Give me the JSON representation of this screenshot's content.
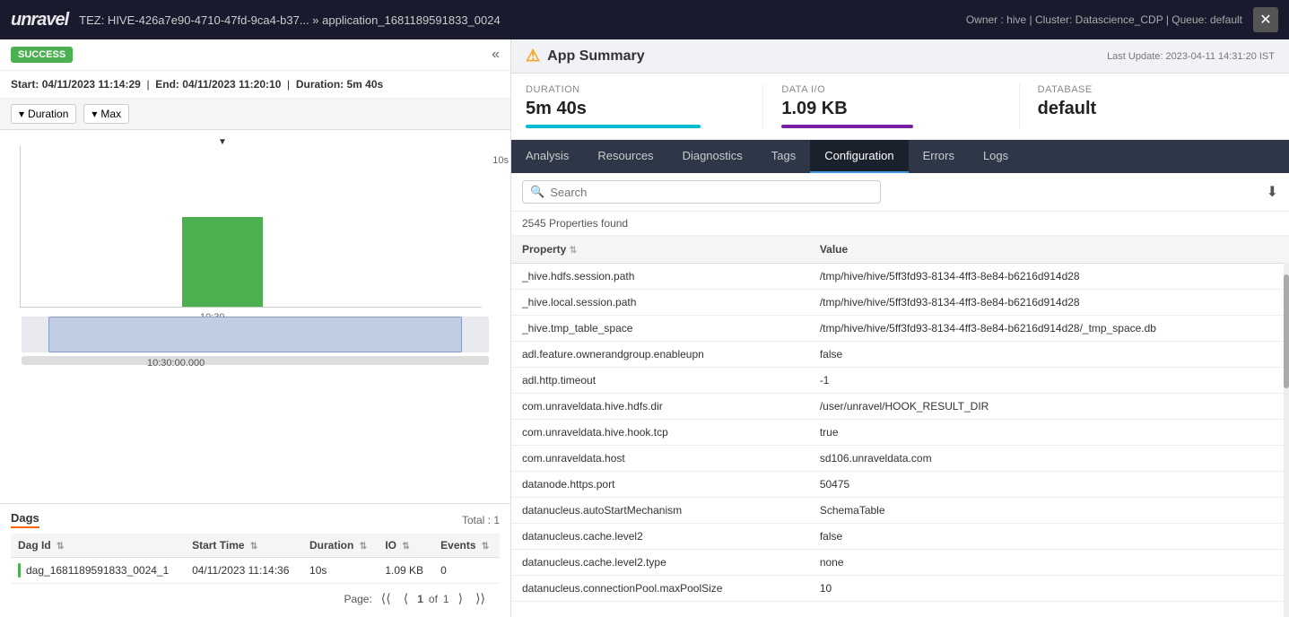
{
  "header": {
    "logo": "unravel",
    "title": "TEZ: HIVE-426a7e90-4710-47fd-9ca4-b37... » application_1681189591833_0024",
    "meta": "Owner : hive | Cluster: Datascience_CDP | Queue: default",
    "close_label": "✕"
  },
  "left_panel": {
    "status": "SUCCESS",
    "collapse_icon": "«",
    "time_info": {
      "start_label": "Start:",
      "start_value": "04/11/2023 11:14:29",
      "end_label": "End:",
      "end_value": "04/11/2023 11:20:10",
      "duration_label": "Duration:",
      "duration_value": "5m 40s"
    },
    "controls": {
      "duration_label": "Duration",
      "max_label": "Max"
    },
    "chart": {
      "y_axis_label": "10s",
      "x_axis_label": "10:30",
      "timestamp": "10:30:00.000"
    },
    "dags": {
      "title": "Dags",
      "total": "Total : 1",
      "columns": [
        "Dag Id",
        "Start Time",
        "Duration",
        "IO",
        "Events"
      ],
      "rows": [
        {
          "dag_id": "dag_1681189591833_0024_1",
          "start_time": "04/11/2023 11:14:36",
          "duration": "10s",
          "io": "1.09 KB",
          "events": "0"
        }
      ],
      "pagination": {
        "page_label": "Page:",
        "current_page": "1",
        "of_label": "of",
        "total_pages": "1"
      }
    }
  },
  "right_panel": {
    "app_summary": {
      "title": "App Summary",
      "last_update": "Last Update: 2023-04-11 14:31:20 IST",
      "warning_icon": "⚠"
    },
    "metrics": [
      {
        "label": "DURATION",
        "value": "5m 40s",
        "bar_class": "bar-cyan"
      },
      {
        "label": "DATA I/O",
        "value": "1.09 KB",
        "bar_class": "bar-purple"
      },
      {
        "label": "DATABASE",
        "value": "default",
        "bar_class": null
      }
    ],
    "tabs": [
      {
        "label": "Analysis",
        "active": false
      },
      {
        "label": "Resources",
        "active": false
      },
      {
        "label": "Diagnostics",
        "active": false
      },
      {
        "label": "Tags",
        "active": false
      },
      {
        "label": "Configuration",
        "active": true
      },
      {
        "label": "Errors",
        "active": false
      },
      {
        "label": "Logs",
        "active": false
      }
    ],
    "configuration": {
      "search_placeholder": "Search",
      "props_count": "2545 Properties found",
      "download_icon": "⬇",
      "columns": [
        "Property",
        "Value"
      ],
      "rows": [
        {
          "property": "_hive.hdfs.session.path",
          "value": "/tmp/hive/hive/5ff3fd93-8134-4ff3-8e84-b6216d914d28"
        },
        {
          "property": "_hive.local.session.path",
          "value": "/tmp/hive/hive/5ff3fd93-8134-4ff3-8e84-b6216d914d28"
        },
        {
          "property": "_hive.tmp_table_space",
          "value": "/tmp/hive/hive/5ff3fd93-8134-4ff3-8e84-b6216d914d28/_tmp_space.db"
        },
        {
          "property": "adl.feature.ownerandgroup.enableupn",
          "value": "false"
        },
        {
          "property": "adl.http.timeout",
          "value": "-1"
        },
        {
          "property": "com.unraveldata.hive.hdfs.dir",
          "value": "/user/unravel/HOOK_RESULT_DIR"
        },
        {
          "property": "com.unraveldata.hive.hook.tcp",
          "value": "true"
        },
        {
          "property": "com.unraveldata.host",
          "value": "sd106.unraveldata.com"
        },
        {
          "property": "datanode.https.port",
          "value": "50475"
        },
        {
          "property": "datanucleus.autoStartMechanism",
          "value": "SchemaTable"
        },
        {
          "property": "datanucleus.cache.level2",
          "value": "false"
        },
        {
          "property": "datanucleus.cache.level2.type",
          "value": "none"
        },
        {
          "property": "datanucleus.connectionPool.maxPoolSize",
          "value": "10"
        }
      ]
    }
  }
}
